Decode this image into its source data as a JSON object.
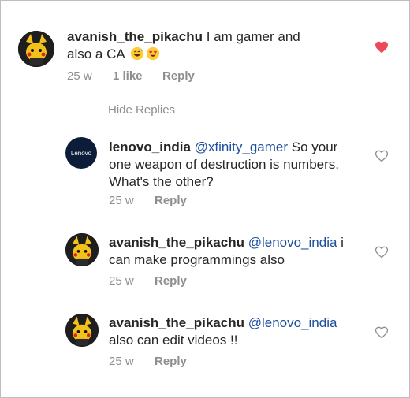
{
  "comments": [
    {
      "username": "avanish_the_pikachu",
      "text_before_emoji": " I am gamer and also a CA ",
      "emoji_icons": [
        "grinning-sweat-emoji-icon",
        "heart-eyes-emoji-icon"
      ],
      "time": "25 w",
      "likes": "1 like",
      "reply_label": "Reply",
      "liked": true,
      "heart_color": "#ed4956"
    }
  ],
  "hide_replies_label": "Hide Replies",
  "replies": [
    {
      "username": "lenovo_india",
      "avatar_logo_text": "Lenovo",
      "mention": "@xfinity_gamer",
      "text": " So your one weapon of destruction is numbers. What's the other?",
      "time": "25 w",
      "reply_label": "Reply",
      "liked": false
    },
    {
      "username": "avanish_the_pikachu",
      "mention": "@lenovo_india",
      "text": " i can make programmings also",
      "time": "25 w",
      "reply_label": "Reply",
      "liked": false
    },
    {
      "username": "avanish_the_pikachu",
      "mention": "@lenovo_india",
      "text": " also can edit videos !!",
      "time": "25 w",
      "reply_label": "Reply",
      "liked": false
    }
  ],
  "colors": {
    "text": "#262626",
    "muted": "#8e8e8e",
    "mention": "#1d4f9c",
    "heart_liked": "#ed4956",
    "lenovo_bg": "#0c1d3a"
  }
}
